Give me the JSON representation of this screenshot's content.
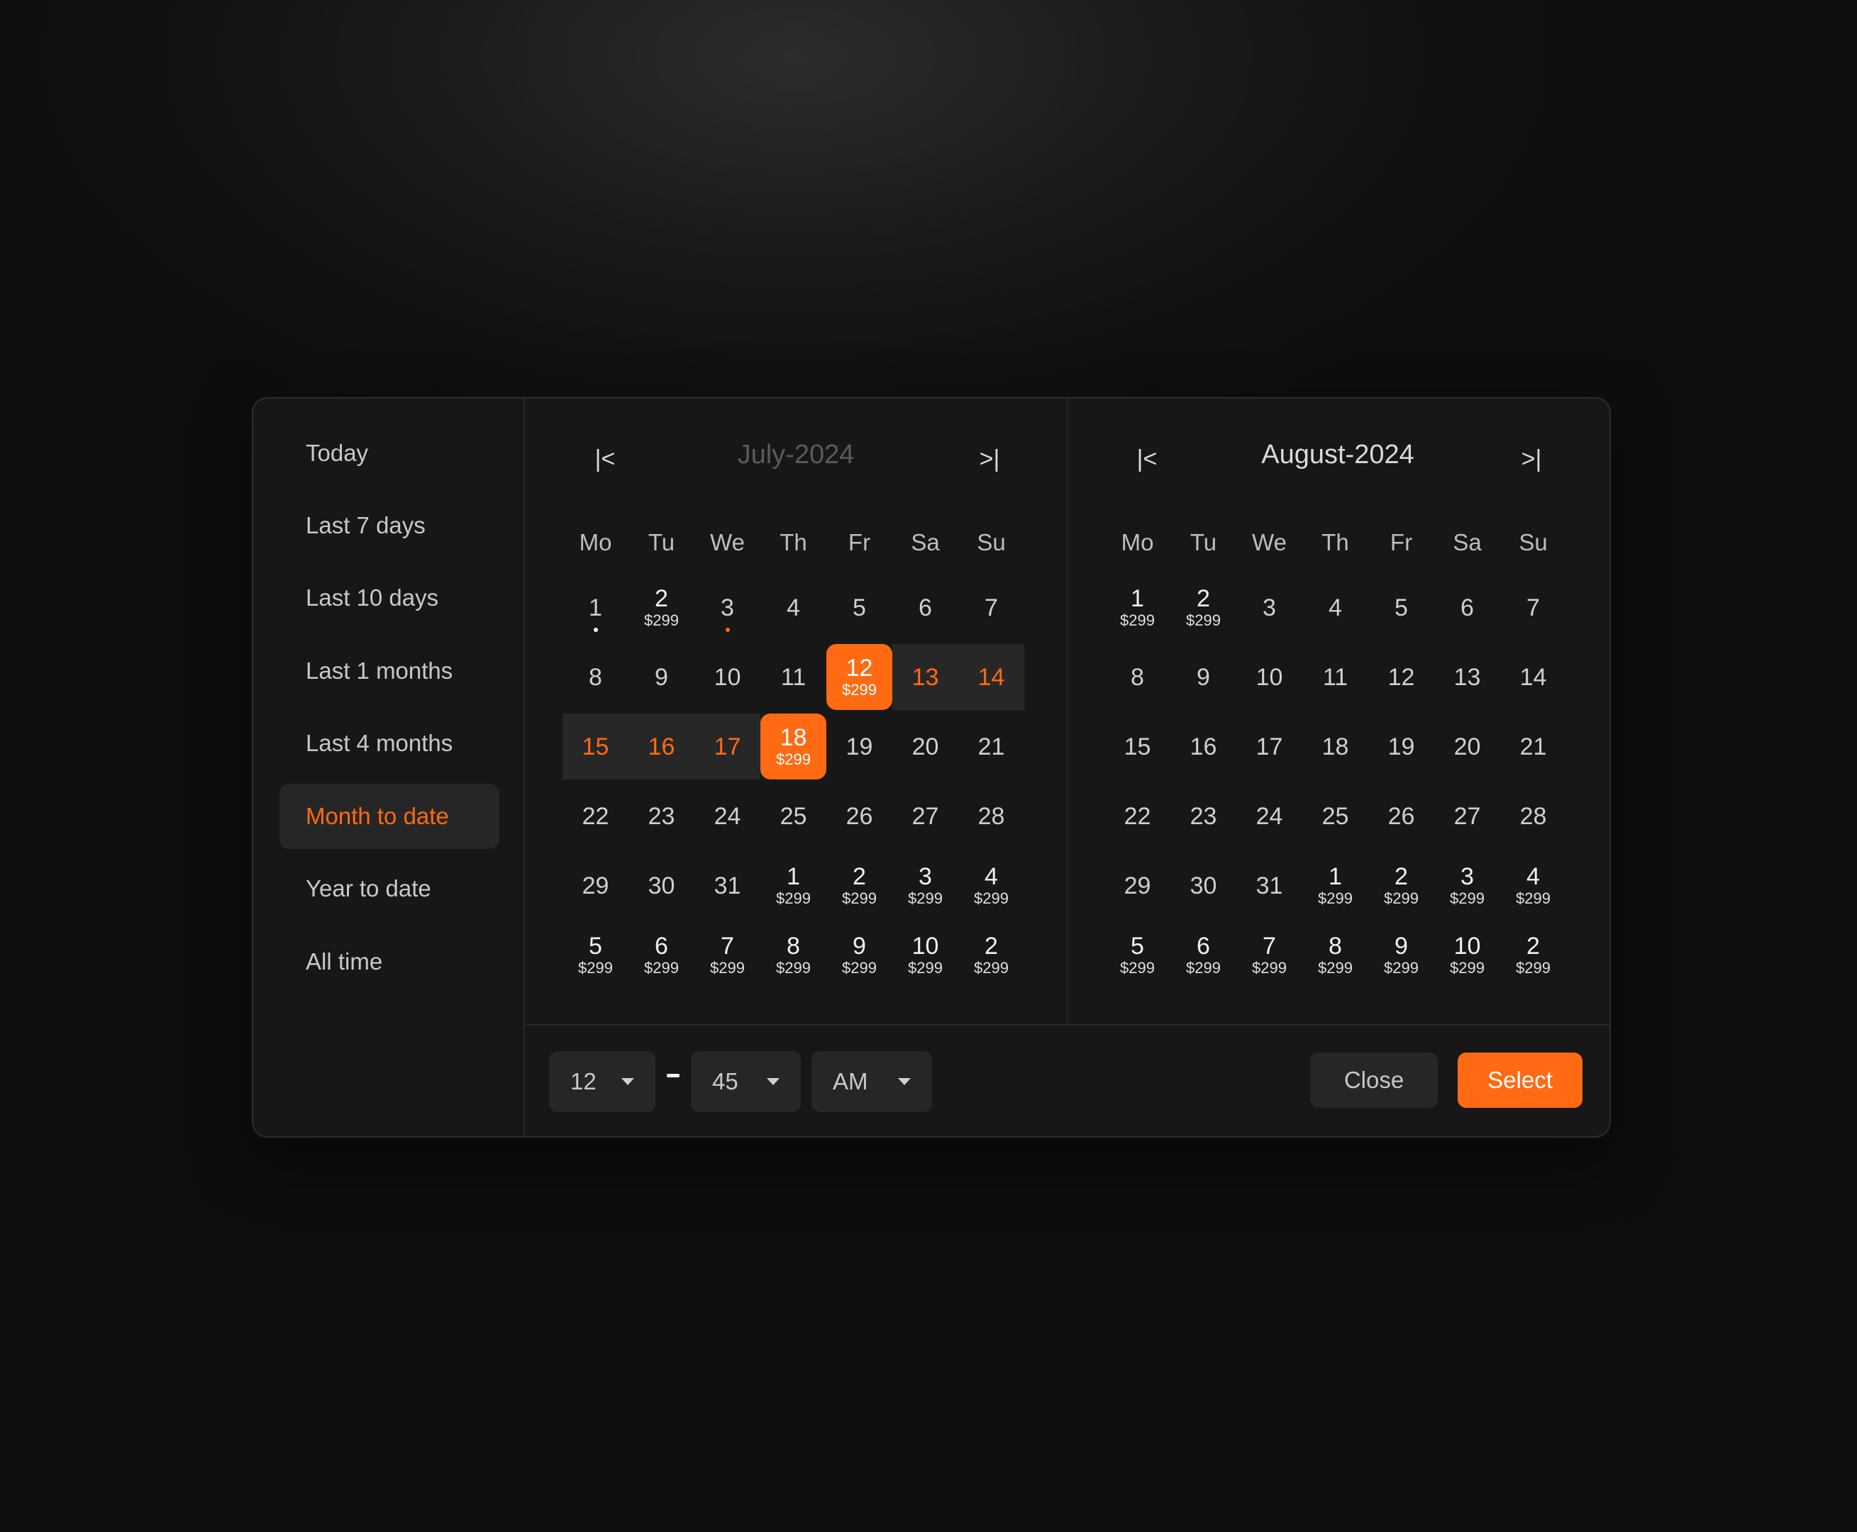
{
  "presets": [
    "Today",
    "Last 7 days",
    "Last 10 days",
    "Last 1 months",
    "Last 4 months",
    "Month to date",
    "Year to date",
    "All time"
  ],
  "active_preset": "Month to date",
  "weekdays": [
    "Mo",
    "Tu",
    "We",
    "Th",
    "Fr",
    "Sa",
    "Su"
  ],
  "nav": {
    "prev_icon": "first-page-icon",
    "next_icon": "last-page-icon",
    "prev_glyph": "|<",
    "next_glyph": ">|"
  },
  "months": [
    {
      "title": "July-2024",
      "weeks": [
        [
          {
            "d": "1",
            "dot": "white"
          },
          {
            "d": "2",
            "p": "$299"
          },
          {
            "d": "3",
            "dot": "orange"
          },
          {
            "d": "4"
          },
          {
            "d": "5"
          },
          {
            "d": "6"
          },
          {
            "d": "7"
          }
        ],
        [
          {
            "d": "8"
          },
          {
            "d": "9"
          },
          {
            "d": "10"
          },
          {
            "d": "11"
          },
          {
            "d": "12",
            "p": "$299",
            "state": "selected"
          },
          {
            "d": "13",
            "state": "range"
          },
          {
            "d": "14",
            "state": "range"
          }
        ],
        [
          {
            "d": "15",
            "state": "range"
          },
          {
            "d": "16",
            "state": "range"
          },
          {
            "d": "17",
            "state": "range"
          },
          {
            "d": "18",
            "p": "$299",
            "state": "selected"
          },
          {
            "d": "19"
          },
          {
            "d": "20"
          },
          {
            "d": "21"
          }
        ],
        [
          {
            "d": "22"
          },
          {
            "d": "23"
          },
          {
            "d": "24"
          },
          {
            "d": "25"
          },
          {
            "d": "26"
          },
          {
            "d": "27"
          },
          {
            "d": "28"
          }
        ],
        [
          {
            "d": "29"
          },
          {
            "d": "30"
          },
          {
            "d": "31"
          },
          {
            "d": "1",
            "p": "$299"
          },
          {
            "d": "2",
            "p": "$299"
          },
          {
            "d": "3",
            "p": "$299"
          },
          {
            "d": "4",
            "p": "$299"
          }
        ],
        [
          {
            "d": "5",
            "p": "$299"
          },
          {
            "d": "6",
            "p": "$299"
          },
          {
            "d": "7",
            "p": "$299"
          },
          {
            "d": "8",
            "p": "$299"
          },
          {
            "d": "9",
            "p": "$299"
          },
          {
            "d": "10",
            "p": "$299"
          },
          {
            "d": "2",
            "p": "$299"
          }
        ]
      ]
    },
    {
      "title": "August-2024",
      "weeks": [
        [
          {
            "d": "1",
            "p": "$299"
          },
          {
            "d": "2",
            "p": "$299"
          },
          {
            "d": "3"
          },
          {
            "d": "4"
          },
          {
            "d": "5"
          },
          {
            "d": "6"
          },
          {
            "d": "7"
          }
        ],
        [
          {
            "d": "8"
          },
          {
            "d": "9"
          },
          {
            "d": "10"
          },
          {
            "d": "11"
          },
          {
            "d": "12"
          },
          {
            "d": "13"
          },
          {
            "d": "14"
          }
        ],
        [
          {
            "d": "15"
          },
          {
            "d": "16"
          },
          {
            "d": "17"
          },
          {
            "d": "18"
          },
          {
            "d": "19"
          },
          {
            "d": "20"
          },
          {
            "d": "21"
          }
        ],
        [
          {
            "d": "22"
          },
          {
            "d": "23"
          },
          {
            "d": "24"
          },
          {
            "d": "25"
          },
          {
            "d": "26"
          },
          {
            "d": "27"
          },
          {
            "d": "28"
          }
        ],
        [
          {
            "d": "29"
          },
          {
            "d": "30"
          },
          {
            "d": "31"
          },
          {
            "d": "1",
            "p": "$299"
          },
          {
            "d": "2",
            "p": "$299"
          },
          {
            "d": "3",
            "p": "$299"
          },
          {
            "d": "4",
            "p": "$299"
          }
        ],
        [
          {
            "d": "5",
            "p": "$299"
          },
          {
            "d": "6",
            "p": "$299"
          },
          {
            "d": "7",
            "p": "$299"
          },
          {
            "d": "8",
            "p": "$299"
          },
          {
            "d": "9",
            "p": "$299"
          },
          {
            "d": "10",
            "p": "$299"
          },
          {
            "d": "2",
            "p": "$299"
          }
        ]
      ]
    }
  ],
  "time": {
    "hour": "12",
    "minute": "45",
    "period": "AM",
    "caret_icon": "caret-down-icon"
  },
  "actions": {
    "close_label": "Close",
    "select_label": "Select"
  },
  "colors": {
    "accent": "#ff6a13",
    "panel": "#171717",
    "surface": "#262626"
  }
}
